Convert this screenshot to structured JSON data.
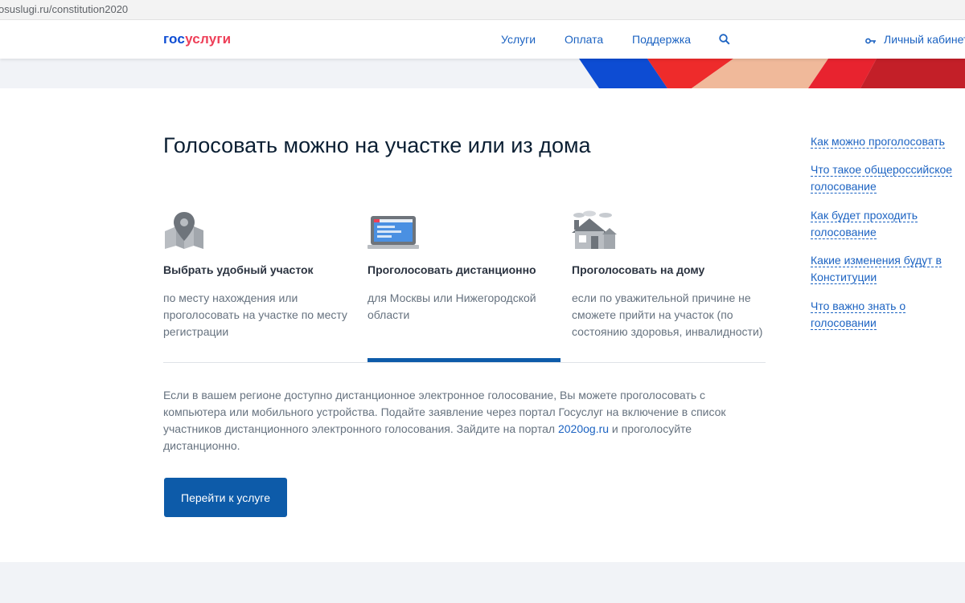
{
  "browser": {
    "url": "osuslugi.ru/constitution2020"
  },
  "header": {
    "logo_part1": "гос",
    "logo_part2": "услуги",
    "nav": [
      "Услуги",
      "Оплата",
      "Поддержка"
    ],
    "cabinet_label": "Личный кабинет"
  },
  "main": {
    "title": "Голосовать можно на участке или из дома",
    "options": [
      {
        "icon": "map-pin-icon",
        "title": "Выбрать удобный участок",
        "desc": "по месту нахождения или проголосовать на участке по месту регистрации"
      },
      {
        "icon": "laptop-icon",
        "title": "Проголосовать дистанционно",
        "desc": "для Москвы или Нижегородской области"
      },
      {
        "icon": "house-icon",
        "title": "Проголосовать на дому",
        "desc": "если по уважительной причине не сможете прийти на участок (по состоянию здоровья, инвалидности)"
      }
    ],
    "active_option": 1,
    "info_before": "Если в вашем регионе доступно дистанционное электронное голосование, Вы можете проголосовать с компьютера или мобильного устройства. Подайте заявление через портал Госуслуг на включение в список участников дистанционного электронного голосования. Зайдите на портал ",
    "info_link": "2020og.ru",
    "info_after": " и проголосуйте дистанционно.",
    "cta_label": "Перейти к услуге"
  },
  "sidebar": {
    "links": [
      "Как можно проголосовать",
      "Что такое общероссийское голосование",
      "Как будет проходить голосование",
      "Какие изменения будут в Конституции",
      "Что важно знать о голосовании"
    ]
  },
  "colors": {
    "accent": "#0d5ba9",
    "link": "#1c63c2",
    "brand_blue": "#0d4cd3",
    "brand_red": "#ee3f58"
  }
}
